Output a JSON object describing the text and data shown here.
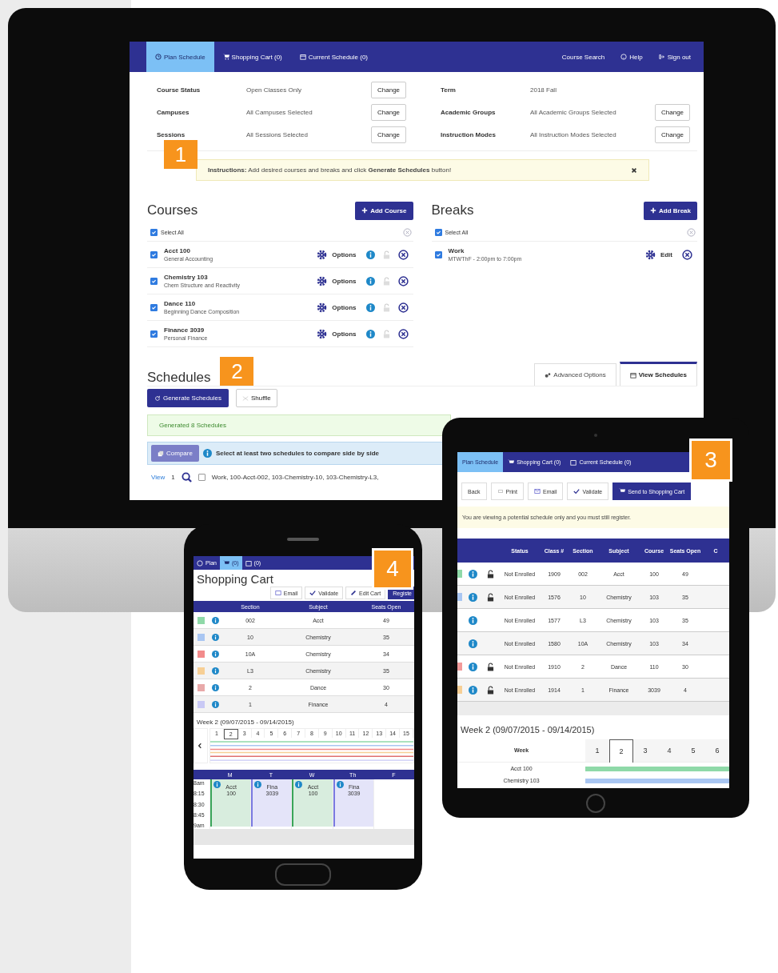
{
  "monitor": {
    "nav": {
      "tabs": [
        {
          "label": "Plan Schedule",
          "kind": "plan",
          "selected": true
        },
        {
          "label": "Shopping Cart (0)",
          "kind": "cart",
          "selected": false
        },
        {
          "label": "Current Schedule (0)",
          "kind": "calendar",
          "selected": false
        }
      ],
      "links": [
        {
          "label": "Course Search",
          "kind": "text"
        },
        {
          "label": "Help",
          "kind": "help"
        },
        {
          "label": "Sign out",
          "kind": "signout"
        }
      ]
    },
    "filters": [
      {
        "label": "Course Status",
        "value": "Open Classes Only",
        "button": "Change"
      },
      {
        "label": "Term",
        "value": "2018 Fall"
      },
      {
        "label": "Campuses",
        "value": "All Campuses Selected",
        "button": "Change"
      },
      {
        "label": "Academic Groups",
        "value": "All Academic Groups Selected",
        "button": "Change"
      },
      {
        "label": "Sessions",
        "value": "All Sessions Selected",
        "button": "Change"
      },
      {
        "label": "Instruction Modes",
        "value": "All Instruction Modes Selected",
        "button": "Change"
      }
    ],
    "instruction": "**Instructions:** Add desired courses and breaks and click **Generate Schedules** button!",
    "courses": {
      "step": "1",
      "title": "Courses",
      "add_button": "Add Course",
      "select_all": {
        "label": "Select All",
        "checked": true
      },
      "items": [
        {
          "name": "Acct 100",
          "description": "General Accounting",
          "checked": true,
          "options": "Options",
          "locked": false
        },
        {
          "name": "Chemistry 103",
          "description": "Chem Structure and Reactivity",
          "checked": true,
          "options": "Options",
          "locked": false
        },
        {
          "name": "Dance 110",
          "description": "Beginning Dance Composition",
          "checked": true,
          "options": "Options",
          "locked": false
        },
        {
          "name": "Finance 3039",
          "description": "Personal Finance",
          "checked": true,
          "options": "Options",
          "locked": false
        }
      ]
    },
    "breaks": {
      "title": "Breaks",
      "add_button": "Add Break",
      "select_all": {
        "label": "Select All",
        "checked": true
      },
      "items": [
        {
          "name": "Work",
          "description": "MTWThF - 2:00pm to 7:00pm",
          "checked": true,
          "edit": "Edit"
        }
      ]
    },
    "schedules": {
      "step": "2",
      "title": "Schedules",
      "tabs": [
        {
          "label": "Advanced Options",
          "kind": "gears",
          "selected": false
        },
        {
          "label": "View Schedules",
          "kind": "calendar",
          "selected": true
        }
      ],
      "generate_button": "Generate Schedules",
      "shuffle_button": "Shuffle",
      "success": "Generated 8 Schedules",
      "compare_button": "Compare",
      "compare_hint": "Select at least two schedules to compare side by side",
      "result": {
        "view": "View",
        "number": "1",
        "checked": false,
        "text": "Work, 100-Acct-002, 103-Chemistry-10, 103-Chemistry-L3,"
      }
    }
  },
  "tablet": {
    "step": "3",
    "nav": {
      "tabs": [
        {
          "label": "Plan Schedule",
          "kind": "plan",
          "selected": true
        },
        {
          "label": "Shopping Cart (0)",
          "kind": "cart",
          "selected": false
        },
        {
          "label": "Current Schedule (0)",
          "kind": "calendar",
          "selected": false
        }
      ]
    },
    "buttons": [
      {
        "label": "Back",
        "kind": "plain"
      },
      {
        "label": "Print",
        "kind": "print"
      },
      {
        "label": "Email",
        "kind": "email"
      },
      {
        "label": "Validate",
        "kind": "validate"
      },
      {
        "label": "Send to Shopping Cart",
        "kind": "cart"
      }
    ],
    "notice": "You are viewing a potential schedule only and you must still register.",
    "table": {
      "columns": [
        "Status",
        "Class #",
        "Section",
        "Subject",
        "Course",
        "Seats Open",
        "C"
      ],
      "rows": [
        {
          "color": "#8fd9a8",
          "locked": true,
          "status": "Not Enrolled",
          "class": "1909",
          "section": "002",
          "subject": "Acct",
          "course": "100",
          "seats": "49"
        },
        {
          "color": "#a9c6f2",
          "locked": true,
          "status": "Not Enrolled",
          "class": "1576",
          "section": "10",
          "subject": "Chemistry",
          "course": "103",
          "seats": "35"
        },
        {
          "locked": false,
          "status": "Not Enrolled",
          "class": "1577",
          "section": "L3",
          "subject": "Chemistry",
          "course": "103",
          "seats": "35"
        },
        {
          "locked": false,
          "status": "Not Enrolled",
          "class": "1580",
          "section": "10A",
          "subject": "Chemistry",
          "course": "103",
          "seats": "34"
        },
        {
          "color": "#f29a9a",
          "locked": true,
          "status": "Not Enrolled",
          "class": "1910",
          "section": "2",
          "subject": "Dance",
          "course": "110",
          "seats": "30"
        },
        {
          "color": "#f7cf95",
          "locked": true,
          "status": "Not Enrolled",
          "class": "1914",
          "section": "1",
          "subject": "Finance",
          "course": "3039",
          "seats": "4"
        }
      ]
    },
    "week": {
      "title": "Week 2 (09/07/2015 - 09/14/2015)",
      "header": "Week",
      "weeks": [
        {
          "label": "1",
          "selected": false
        },
        {
          "label": "2",
          "selected": true
        },
        {
          "label": "3",
          "selected": false
        },
        {
          "label": "4",
          "selected": false
        },
        {
          "label": "5",
          "selected": false
        },
        {
          "label": "6",
          "selected": false
        }
      ],
      "rows": [
        {
          "label": "Acct 100",
          "color": "#8fd9a8"
        },
        {
          "label": "Chemistry 103",
          "color": "#a9c6f2"
        }
      ]
    }
  },
  "phone": {
    "step": "4",
    "nav": {
      "tabs": [
        {
          "label": "Plan",
          "kind": "plan",
          "selected": false
        },
        {
          "label": "(0)",
          "kind": "cart",
          "selected": true
        },
        {
          "label": "(0)",
          "kind": "calendar",
          "selected": false
        }
      ]
    },
    "title": "Shopping Cart",
    "buttons": [
      {
        "label": "Email",
        "kind": "email"
      },
      {
        "label": "Validate",
        "kind": "validate"
      },
      {
        "label": "Edit Cart",
        "kind": "edit"
      },
      {
        "label": "Registe",
        "kind": "primary"
      }
    ],
    "table": {
      "columns": [
        "Section",
        "Subject",
        "Seats Open"
      ],
      "rows": [
        {
          "color": "#8fd9a8",
          "section": "002",
          "subject": "Acct",
          "seats": "49"
        },
        {
          "color": "#a9c6f2",
          "section": "10",
          "subject": "Chemistry",
          "seats": "35"
        },
        {
          "color": "#f28b8b",
          "section": "10A",
          "subject": "Chemistry",
          "seats": "34"
        },
        {
          "color": "#f7cf95",
          "section": "L3",
          "subject": "Chemistry",
          "seats": "35"
        },
        {
          "color": "#e8a9a9",
          "section": "2",
          "subject": "Dance",
          "seats": "30"
        },
        {
          "color": "#c9c9f5",
          "section": "1",
          "subject": "Finance",
          "seats": "4"
        }
      ]
    },
    "week": {
      "title": "Week 2 (09/07/2015 - 09/14/2015)",
      "weeks": [
        {
          "label": "1",
          "selected": false
        },
        {
          "label": "2",
          "selected": true
        },
        {
          "label": "3",
          "selected": false
        },
        {
          "label": "4",
          "selected": false
        },
        {
          "label": "5",
          "selected": false
        },
        {
          "label": "6",
          "selected": false
        },
        {
          "label": "7",
          "selected": false
        },
        {
          "label": "8",
          "selected": false
        },
        {
          "label": "9",
          "selected": false
        },
        {
          "label": "10",
          "selected": false
        },
        {
          "label": "11",
          "selected": false
        },
        {
          "label": "12",
          "selected": false
        },
        {
          "label": "13",
          "selected": false
        },
        {
          "label": "14",
          "selected": false
        },
        {
          "label": "15",
          "selected": false
        }
      ]
    },
    "calendar": {
      "times": [
        "8am",
        "8:15",
        "8:30",
        "8:45",
        "9am"
      ],
      "days": [
        {
          "label": "M",
          "event": {
            "line1": "Acct",
            "line2": "100",
            "color": "#3aa55a"
          }
        },
        {
          "label": "T",
          "event": {
            "line1": "Fina",
            "line2": "3039",
            "color": "#7a7ae0"
          }
        },
        {
          "label": "W",
          "event": {
            "line1": "Acct",
            "line2": "100",
            "color": "#3aa55a"
          }
        },
        {
          "label": "Th",
          "event": {
            "line1": "Fina",
            "line2": "3039",
            "color": "#7a7ae0"
          }
        },
        {
          "label": "F"
        }
      ]
    }
  }
}
